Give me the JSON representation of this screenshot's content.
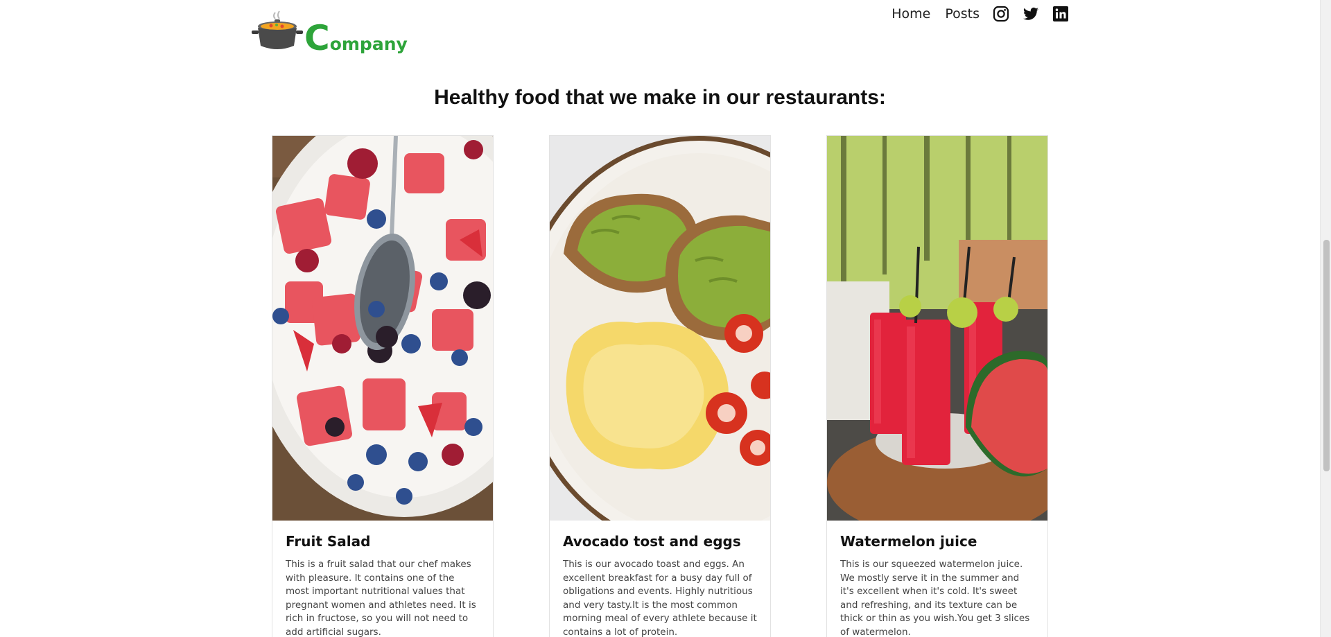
{
  "header": {
    "logo": {
      "lead_letter": "C",
      "rest": "ompany"
    },
    "nav": [
      {
        "label": "Home"
      },
      {
        "label": "Posts"
      }
    ],
    "social_icons": [
      "instagram-icon",
      "twitter-icon",
      "linkedin-icon"
    ]
  },
  "main": {
    "title": "Healthy food that we make in our restaurants:",
    "cards": [
      {
        "title": "Fruit Salad",
        "text": "This is a fruit salad that our chef makes with pleasure. It contains one of the most important nutritional values that pregnant women and athletes need. It is rich in fructose, so you will not need to add artificial sugars."
      },
      {
        "title": "Avocado tost and eggs",
        "text": "This is our avocado toast and eggs. An excellent breakfast for a busy day full of obligations and events. Highly nutritious and very tasty.It is the most common morning meal of every athlete because it contains a lot of protein."
      },
      {
        "title": "Watermelon juice",
        "text": "This is our squeezed watermelon juice. We mostly serve it in the summer and it's excellent when it's cold. It's sweet and refreshing, and its texture can be thick or thin as you wish.You get 3 slices of watermelon."
      }
    ]
  },
  "colors": {
    "logo_green": "#2ea43a",
    "text": "#111111",
    "body_text": "#444444",
    "card_border": "#e2e2e2"
  }
}
